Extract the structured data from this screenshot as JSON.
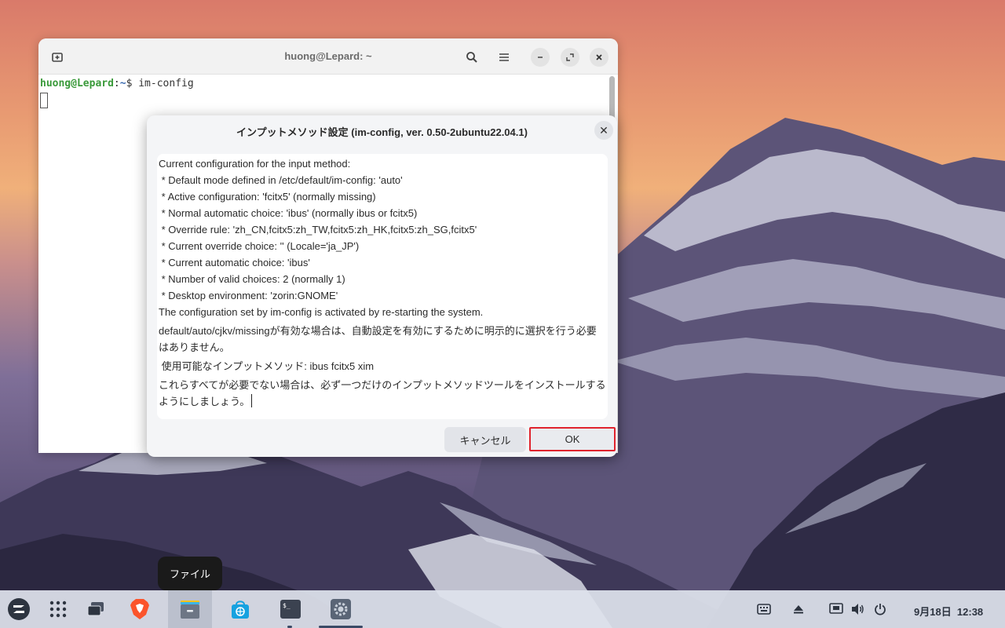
{
  "terminal": {
    "title": "huong@Lepard: ~",
    "prompt_user": "huong@Lepard",
    "prompt_sep": ":",
    "prompt_path": "~",
    "prompt_symbol": "$ ",
    "command": "im-config"
  },
  "dialog": {
    "title": "インプットメソッド設定 (im-config, ver. 0.50-2ubuntu22.04.1)",
    "lines": [
      "Current configuration for the input method:",
      " * Default mode defined in /etc/default/im-config: 'auto'",
      " * Active configuration: 'fcitx5' (normally missing)",
      " * Normal automatic choice: 'ibus' (normally ibus or fcitx5)",
      " * Override rule: 'zh_CN,fcitx5:zh_TW,fcitx5:zh_HK,fcitx5:zh_SG,fcitx5'",
      " * Current override choice: '' (Locale='ja_JP')",
      " * Current automatic choice: 'ibus'",
      " * Number of valid choices: 2 (normally 1)",
      " * Desktop environment: 'zorin:GNOME'",
      "The configuration set by im-config is activated by re-starting the system."
    ],
    "paragraph_missing": "default/auto/cjkv/missingが有効な場合は、自動設定を有効にするために明示的に選択を行う必要はありません。",
    "paragraph_available": " 使用可能なインプットメソッド: ibus fcitx5 xim",
    "paragraph_install": "これらすべてが必要でない場合は、必ず一つだけのインプットメソッドツールをインストールするようにしましょう。",
    "cancel_label": "キャンセル",
    "ok_label": "OK",
    "close_symbol": "✕"
  },
  "tooltip": {
    "label": "ファイル"
  },
  "taskbar": {
    "clock": "9月18日  12:38"
  },
  "colors": {
    "ok_highlight": "#e0232d",
    "prompt_user": "#3a9a3a",
    "prompt_path": "#3a6ab0"
  }
}
